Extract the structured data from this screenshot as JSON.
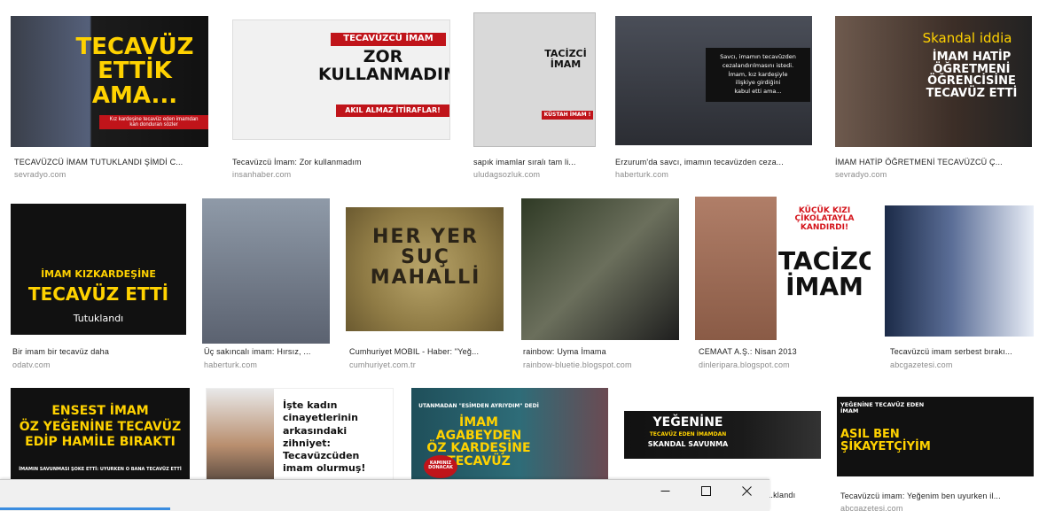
{
  "results": [
    {
      "caption": "TECAVÜZCÜ İMAM TUTUKLANDI ŞİMDİ C...",
      "source": "sevradyo.com",
      "overlay": "TECAVÜZ\nETTİK AMA...",
      "band": "Kız kardeşine tecavüz eden imamdan\nkan donduran sözler"
    },
    {
      "caption": "Tecavüzcü İmam: Zor kullanmadım",
      "source": "insanhaber.com",
      "overlay_top": "TECAVÜZCÜ İMAM",
      "overlay": "ZOR\nKULLANMADIM",
      "overlay_bottom": "AKIL ALMAZ İTİRAFLAR!"
    },
    {
      "caption": "sapık imamlar sıralı tam li...",
      "source": "uludagsozluk.com",
      "overlay": "TACİZCİ\nİMAM",
      "small": "KÜSTAH İMAM !"
    },
    {
      "caption": "Erzurum'da savcı, imamın tecavüzden ceza...",
      "source": "haberturk.com",
      "overlay": "Savcı, imamın tecavüzden\ncezalandırılmasını istedi.\nİmam, kız kardeşiyle\nilişkiye girdiğini\nkabul etti ama..."
    },
    {
      "caption": "İMAM HATİP ÖĞRETMENİ TECAVÜZCÜ Ç...",
      "source": "sevradyo.com",
      "overlay_top": "Skandal iddia",
      "overlay": "İMAM HATİP\nÖĞRETMENİ\nÖĞRENCİSİNE\nTECAVÜZ ETTİ"
    },
    {
      "caption": "Bir imam bir tecavüz daha",
      "source": "odatv.com",
      "overlay_top": "İMAM KIZKARDEŞİNE",
      "overlay": "TECAVÜZ ETTİ",
      "overlay_bottom": "Tutuklandı"
    },
    {
      "caption": "Üç sakıncalı imam: Hırsız, ...",
      "source": "haberturk.com"
    },
    {
      "caption": "Cumhuriyet MOBIL - Haber: \"Yeğ...",
      "source": "cumhuriyet.com.tr",
      "overlay": "HER YER\nSUÇ\nMAHALLİ"
    },
    {
      "caption": "rainbow: Uyma İmama",
      "source": "rainbow-bluetie.blogspot.com"
    },
    {
      "caption": "CEMAAT A.Ş.: Nisan 2013",
      "source": "dinleripara.blogspot.com",
      "overlay_top": "KÜÇÜK KIZI\nÇİKOLATAYLA KANDIRDI!",
      "overlay": "TACİZCİ\nİMAM"
    },
    {
      "caption": "Tecavüzcü imam serbest bırakı...",
      "source": "abcgazetesi.com"
    },
    {
      "caption": "",
      "source": "",
      "overlay": "ENSEST İMAM\nÖZ YEĞENİNE TECAVÜZ\nEDİP HAMİLE BIRAKTI",
      "overlay_bottom": "İMAMIN SAVUNMASI ŞOKE ETTİ: UYURKEN O BANA TECAVÜZ ETTİ"
    },
    {
      "caption": "",
      "source": "",
      "overlay": "İşte kadın\ncinayetlerinin\narkasındaki zihniyet:\nTecavüzcüden\nimam olurmuş!"
    },
    {
      "caption": "",
      "source": "",
      "overlay_top": "UTANMADAN \"ESİMDEN AYRIYDIM\" DEDİ",
      "overlay": "İMAM AGABEYDEN\nÖZ KARDEŞİNE\nTECAVÜZ",
      "badge": "KAMINIZ DONACAK"
    },
    {
      "caption": "...klandı",
      "source": "",
      "overlay": "YEĞENİNE",
      "overlay_mid": "TECAVÜZ EDEN İMAMDAN",
      "overlay_bottom": "SKANDAL SAVUNMA"
    },
    {
      "caption": "Tecavüzcü imam: Yeğenim ben uyurken il...",
      "source": "abcgazetesi.com",
      "overlay_top": "YEĞENİNE TECAVÜZ EDEN\nİMAM",
      "overlay": "ASIL BEN\nŞİKAYETÇİYİM"
    }
  ],
  "window": {
    "minimize_glyph": "—",
    "maximize_glyph": "□",
    "close_glyph": "✕"
  },
  "icons": {
    "minimize": "minimize-icon",
    "maximize": "maximize-icon",
    "close": "close-icon"
  }
}
